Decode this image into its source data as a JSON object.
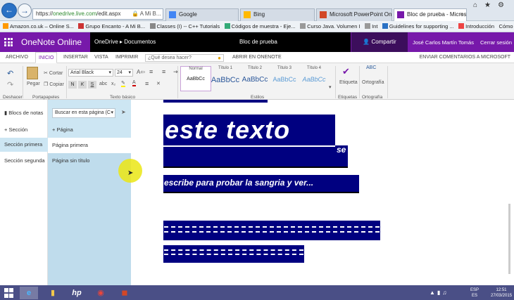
{
  "browser": {
    "url_https": "https://",
    "url_domain": "onedrive.live.com",
    "url_path": "/edit.aspx",
    "security_text": "A Mi B...",
    "tabs": [
      {
        "label": "Google"
      },
      {
        "label": "Bing"
      },
      {
        "label": "Microsoft PowerPoint Online -"
      },
      {
        "label": "Bloc de prueba - Microsoft ..."
      }
    ],
    "favorites": [
      "Amazon.co.uk – Online S...",
      "Grupo Encanto - A Mi B...",
      "Classes (I) -- C++ Tutorials",
      "Códigos de muestra - Eje...",
      "Curso Java. Volumen I",
      "Int",
      "Guidelines for supporting ...",
      "Introducción",
      "Cómo crear..."
    ]
  },
  "header": {
    "app_name": "OneNote Online",
    "breadcrumb_root": "OneDrive",
    "breadcrumb_folder": "Documentos",
    "doc_title": "Bloc de prueba",
    "share_label": "Compartir",
    "user_name": "José Carlos Martín Tomás",
    "sign_out": "Cerrar sesión"
  },
  "ribbon": {
    "tabs": [
      "ARCHIVO",
      "INICIO",
      "INSERTAR",
      "VISTA",
      "IMPRIMIR"
    ],
    "tell_me_placeholder": "¿Qué desea hacer?",
    "open_in_onenote": "ABRIR EN ONENOTE",
    "feedback": "ENVIAR COMENTARIOS A MICROSOFT",
    "undo_group": "Deshacer",
    "paste": "Pegar",
    "cut": "Cortar",
    "copy": "Copiar",
    "clipboard_group": "Portapapeles",
    "font_name": "Arial Black",
    "font_size": "24",
    "bold": "N",
    "italic": "K",
    "underline": "S",
    "basic_text_group": "Texto básico",
    "styles": [
      {
        "name": "Normal",
        "sample": "AaBbCc"
      },
      {
        "name": "Título 1",
        "sample": "AaBbCc"
      },
      {
        "name": "Título 2",
        "sample": "AaBbCc"
      },
      {
        "name": "Título 3",
        "sample": "AaBbCc"
      },
      {
        "name": "Título 4",
        "sample": "AaBbCc"
      }
    ],
    "styles_group": "Estilos",
    "tag": "Etiqueta",
    "tags_group": "Etiquetas",
    "spelling": "Ortografía",
    "spelling_group": "Ortografía"
  },
  "notebooks": {
    "label": "Blocs de notas",
    "add_section": "Sección",
    "sections": [
      "Sección primera",
      "Sección segunda"
    ]
  },
  "pages": {
    "search_placeholder": "Buscar en esta página (C",
    "add_page": "Página",
    "items": [
      "Página primera",
      "Página sin título"
    ]
  },
  "canvas": {
    "big_text": "este texto",
    "se_text": "se",
    "line2": "escribe para probar la sangria y ver..."
  },
  "taskbar": {
    "lang_top": "ESP",
    "lang_bottom": "ES",
    "time": "12:51",
    "date": "27/03/2015"
  },
  "colors": {
    "onenote_purple": "#7719aa",
    "highlight_navy": "#000080",
    "cursor_yellow": "#ebe614"
  }
}
